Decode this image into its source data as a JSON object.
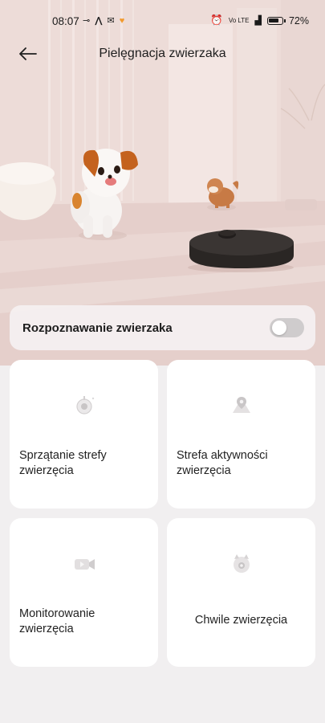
{
  "status_bar": {
    "time": "08:07",
    "battery": "72%",
    "network_label": "Vo LTE"
  },
  "header": {
    "title": "Pielęgnacja zwierzaka",
    "back_icon": "arrow-left-icon"
  },
  "recognition": {
    "label": "Rozpoznawanie zwierzaka",
    "enabled": false
  },
  "features": [
    {
      "label": "Sprzątanie strefy zwierzęcia",
      "icon": "robot-vacuum-icon"
    },
    {
      "label": "Strefa aktywności zwierzęcia",
      "icon": "map-pin-icon"
    },
    {
      "label": "Monitorowanie zwierzęcia",
      "icon": "video-camera-icon"
    },
    {
      "label": "Chwile zwierzęcia",
      "icon": "pet-face-icon"
    }
  ],
  "colors": {
    "background": "#f1eff0",
    "card": "#ffffff",
    "toggle_off": "#cfcccd",
    "hero_tint": "#ead8d4"
  }
}
